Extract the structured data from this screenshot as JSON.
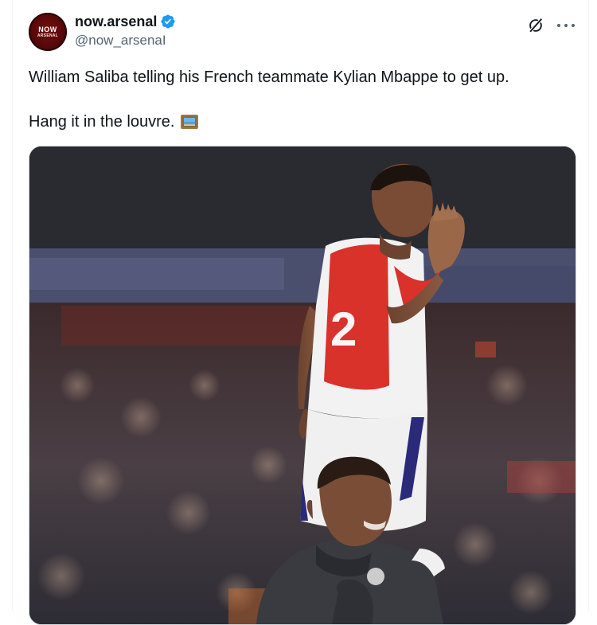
{
  "post": {
    "author": {
      "display_name": "now.arsenal",
      "handle": "@now_arsenaI",
      "verified": true,
      "avatar_logo_text": "NOW",
      "avatar_logo_subtext": "ARSENAL"
    },
    "text_line1": "William Saliba telling his French teammate Kylian Mbappe to get up.",
    "text_line2": "Hang it in the louvre.",
    "emoji": "framed-picture",
    "image": {
      "description_icon": "photo",
      "shirt_number": "2",
      "accent_colors": {
        "arsenal_red": "#d8322b",
        "arsenal_white": "#f4f4f4",
        "shorts_trim": "#2b2a7a",
        "madrid_kit": "#3a3b40"
      }
    }
  },
  "icons": {
    "grok": "grok-icon",
    "more": "more-icon",
    "verified": "verified-badge-icon"
  },
  "colors": {
    "text_primary": "#0f1419",
    "text_secondary": "#536471",
    "verified_blue": "#1d9bf0"
  }
}
